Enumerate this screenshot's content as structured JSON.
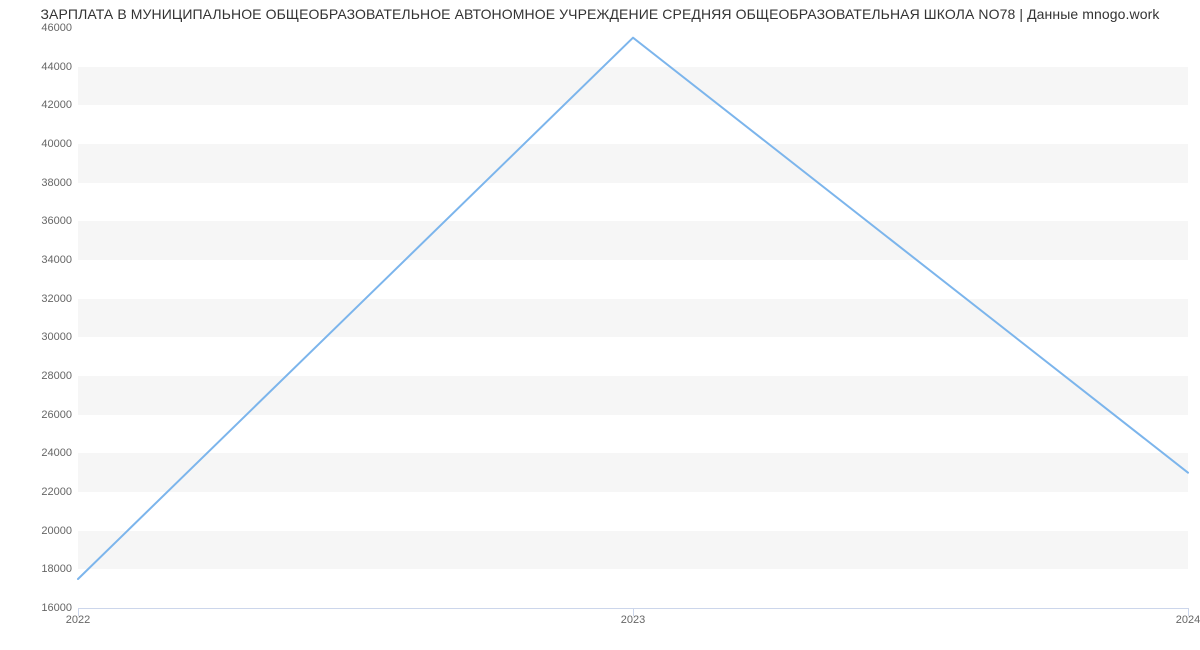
{
  "chart_data": {
    "type": "line",
    "title": "ЗАРПЛАТА В МУНИЦИПАЛЬНОЕ ОБЩЕОБРАЗОВАТЕЛЬНОЕ АВТОНОМНОЕ УЧРЕЖДЕНИЕ СРЕДНЯЯ ОБЩЕОБРАЗОВАТЕЛЬНАЯ ШКОЛА NO78 | Данные mnogo.work",
    "x": [
      "2022",
      "2023",
      "2024"
    ],
    "values": [
      17500,
      45500,
      23000
    ],
    "xlabel": "",
    "ylabel": "",
    "ylim": [
      16000,
      46000
    ],
    "y_ticks": [
      16000,
      18000,
      20000,
      22000,
      24000,
      26000,
      28000,
      30000,
      32000,
      34000,
      36000,
      38000,
      40000,
      42000,
      44000,
      46000
    ],
    "colors": {
      "series": "#7cb5ec",
      "band": "#f6f6f6",
      "axis": "#ccd6eb",
      "tick_text": "#666666"
    }
  }
}
